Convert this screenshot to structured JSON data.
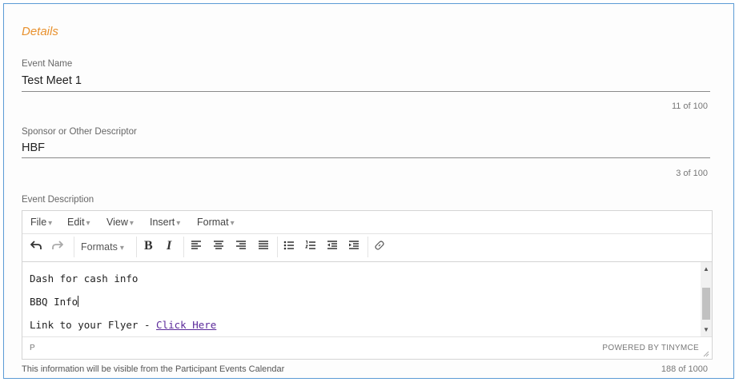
{
  "section": {
    "title": "Details"
  },
  "event_name": {
    "label": "Event Name",
    "value": "Test Meet 1",
    "counter": "11 of 100"
  },
  "sponsor": {
    "label": "Sponsor or Other Descriptor",
    "value": "HBF",
    "counter": "3 of 100"
  },
  "description": {
    "label": "Event Description",
    "menus": [
      "File",
      "Edit",
      "View",
      "Insert",
      "Format"
    ],
    "toolbar": {
      "formats_label": "Formats",
      "bold_label": "B",
      "italic_label": "I",
      "icons": [
        "undo-icon",
        "redo-icon",
        "bold-icon",
        "italic-icon",
        "align-left-icon",
        "align-center-icon",
        "align-right-icon",
        "align-justify-icon",
        "bullet-list-icon",
        "numbered-list-icon",
        "outdent-icon",
        "indent-icon",
        "link-icon"
      ]
    },
    "content": {
      "line1": "Dash for cash info",
      "line2": "BBQ Info",
      "line3_prefix": "Link to your Flyer - ",
      "line3_link": "Click Here"
    },
    "status_path": "P",
    "powered_by": "POWERED BY TINYMCE",
    "helper_text": "This information will be visible from the Participant Events Calendar",
    "counter": "188 of 1000"
  },
  "colors": {
    "section_title": "#e8912e",
    "link": "#5b2a9a",
    "frame_border": "#5b9bd5"
  }
}
